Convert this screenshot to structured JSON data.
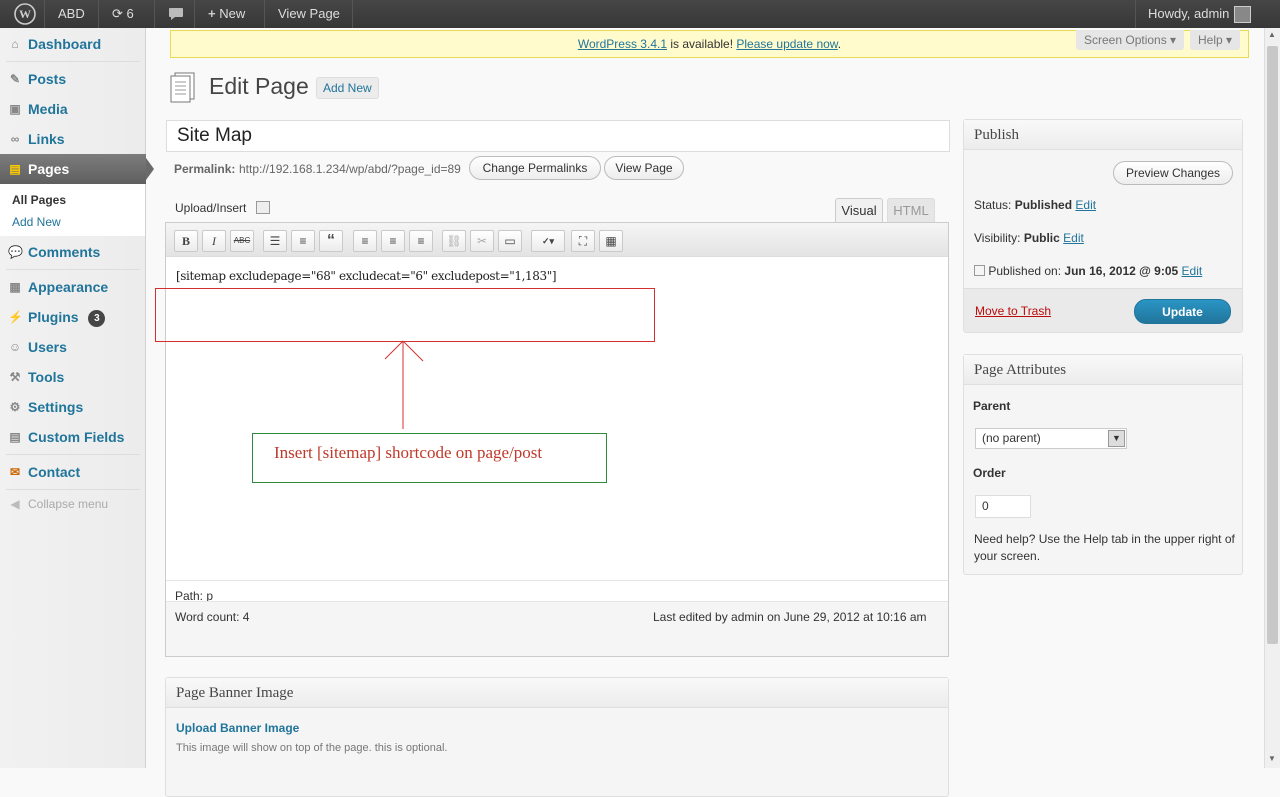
{
  "adminbar": {
    "site_name": "ABD",
    "updates_count": "6",
    "new_label": "New",
    "view_page_label": "View Page",
    "howdy": "Howdy, admin"
  },
  "sidebar": {
    "items": [
      {
        "label": "Dashboard",
        "icon": "home-icon"
      },
      {
        "label": "Posts",
        "icon": "pushpin-icon"
      },
      {
        "label": "Media",
        "icon": "media-icon"
      },
      {
        "label": "Links",
        "icon": "link-icon"
      },
      {
        "label": "Pages",
        "icon": "page-icon"
      },
      {
        "label": "Comments",
        "icon": "comment-icon"
      },
      {
        "label": "Appearance",
        "icon": "appearance-icon"
      },
      {
        "label": "Plugins",
        "icon": "plug-icon",
        "badge": "3"
      },
      {
        "label": "Users",
        "icon": "users-icon"
      },
      {
        "label": "Tools",
        "icon": "tools-icon"
      },
      {
        "label": "Settings",
        "icon": "settings-icon"
      },
      {
        "label": "Custom Fields",
        "icon": "fields-icon"
      },
      {
        "label": "Contact",
        "icon": "contact-icon"
      }
    ],
    "sub_all_pages": "All Pages",
    "sub_add_new": "Add New",
    "collapse": "Collapse menu"
  },
  "notice": {
    "link1": "WordPress 3.4.1",
    "text": " is available! ",
    "link2": "Please update now",
    "end": "."
  },
  "screen_options": "Screen Options",
  "help": "Help",
  "page": {
    "heading": "Edit Page",
    "add_new": "Add New",
    "title_value": "Site Map",
    "permalink_label": "Permalink:",
    "permalink_url": "http://192.168.1.234/wp/abd/?page_id=89",
    "change_permalinks": "Change Permalinks",
    "view_page": "View Page",
    "upload_insert": "Upload/Insert",
    "tab_visual": "Visual",
    "tab_html": "HTML"
  },
  "editor": {
    "content": "[sitemap excludepage=\"68\" excludecat=\"6\" excludepost=\"1,183\"]",
    "annotation": "Insert [sitemap] shortcode on page/post",
    "path_label": "Path:",
    "path_value": "p",
    "word_count": "Word count: 4",
    "last_edited": "Last edited by admin on June 29, 2012 at 10:16 am"
  },
  "publish": {
    "title": "Publish",
    "preview": "Preview Changes",
    "status_label": "Status:",
    "status_value": "Published",
    "visibility_label": "Visibility:",
    "visibility_value": "Public",
    "edit": "Edit",
    "published_on_label": "Published on:",
    "published_on_value": "Jun 16, 2012 @ 9:05",
    "trash": "Move to Trash",
    "update": "Update"
  },
  "attributes": {
    "title": "Page Attributes",
    "parent_label": "Parent",
    "parent_value": "(no parent)",
    "order_label": "Order",
    "order_value": "0",
    "help": "Need help? Use the Help tab in the upper right of your screen."
  },
  "banner": {
    "title": "Page Banner Image",
    "upload": "Upload Banner Image",
    "desc": "This image will show on top of the page. this is optional."
  },
  "colors": {
    "accent": "#21759b",
    "update_button": "#2a84bd",
    "trash": "#bc0b0b",
    "annotation": "#c0392b"
  }
}
